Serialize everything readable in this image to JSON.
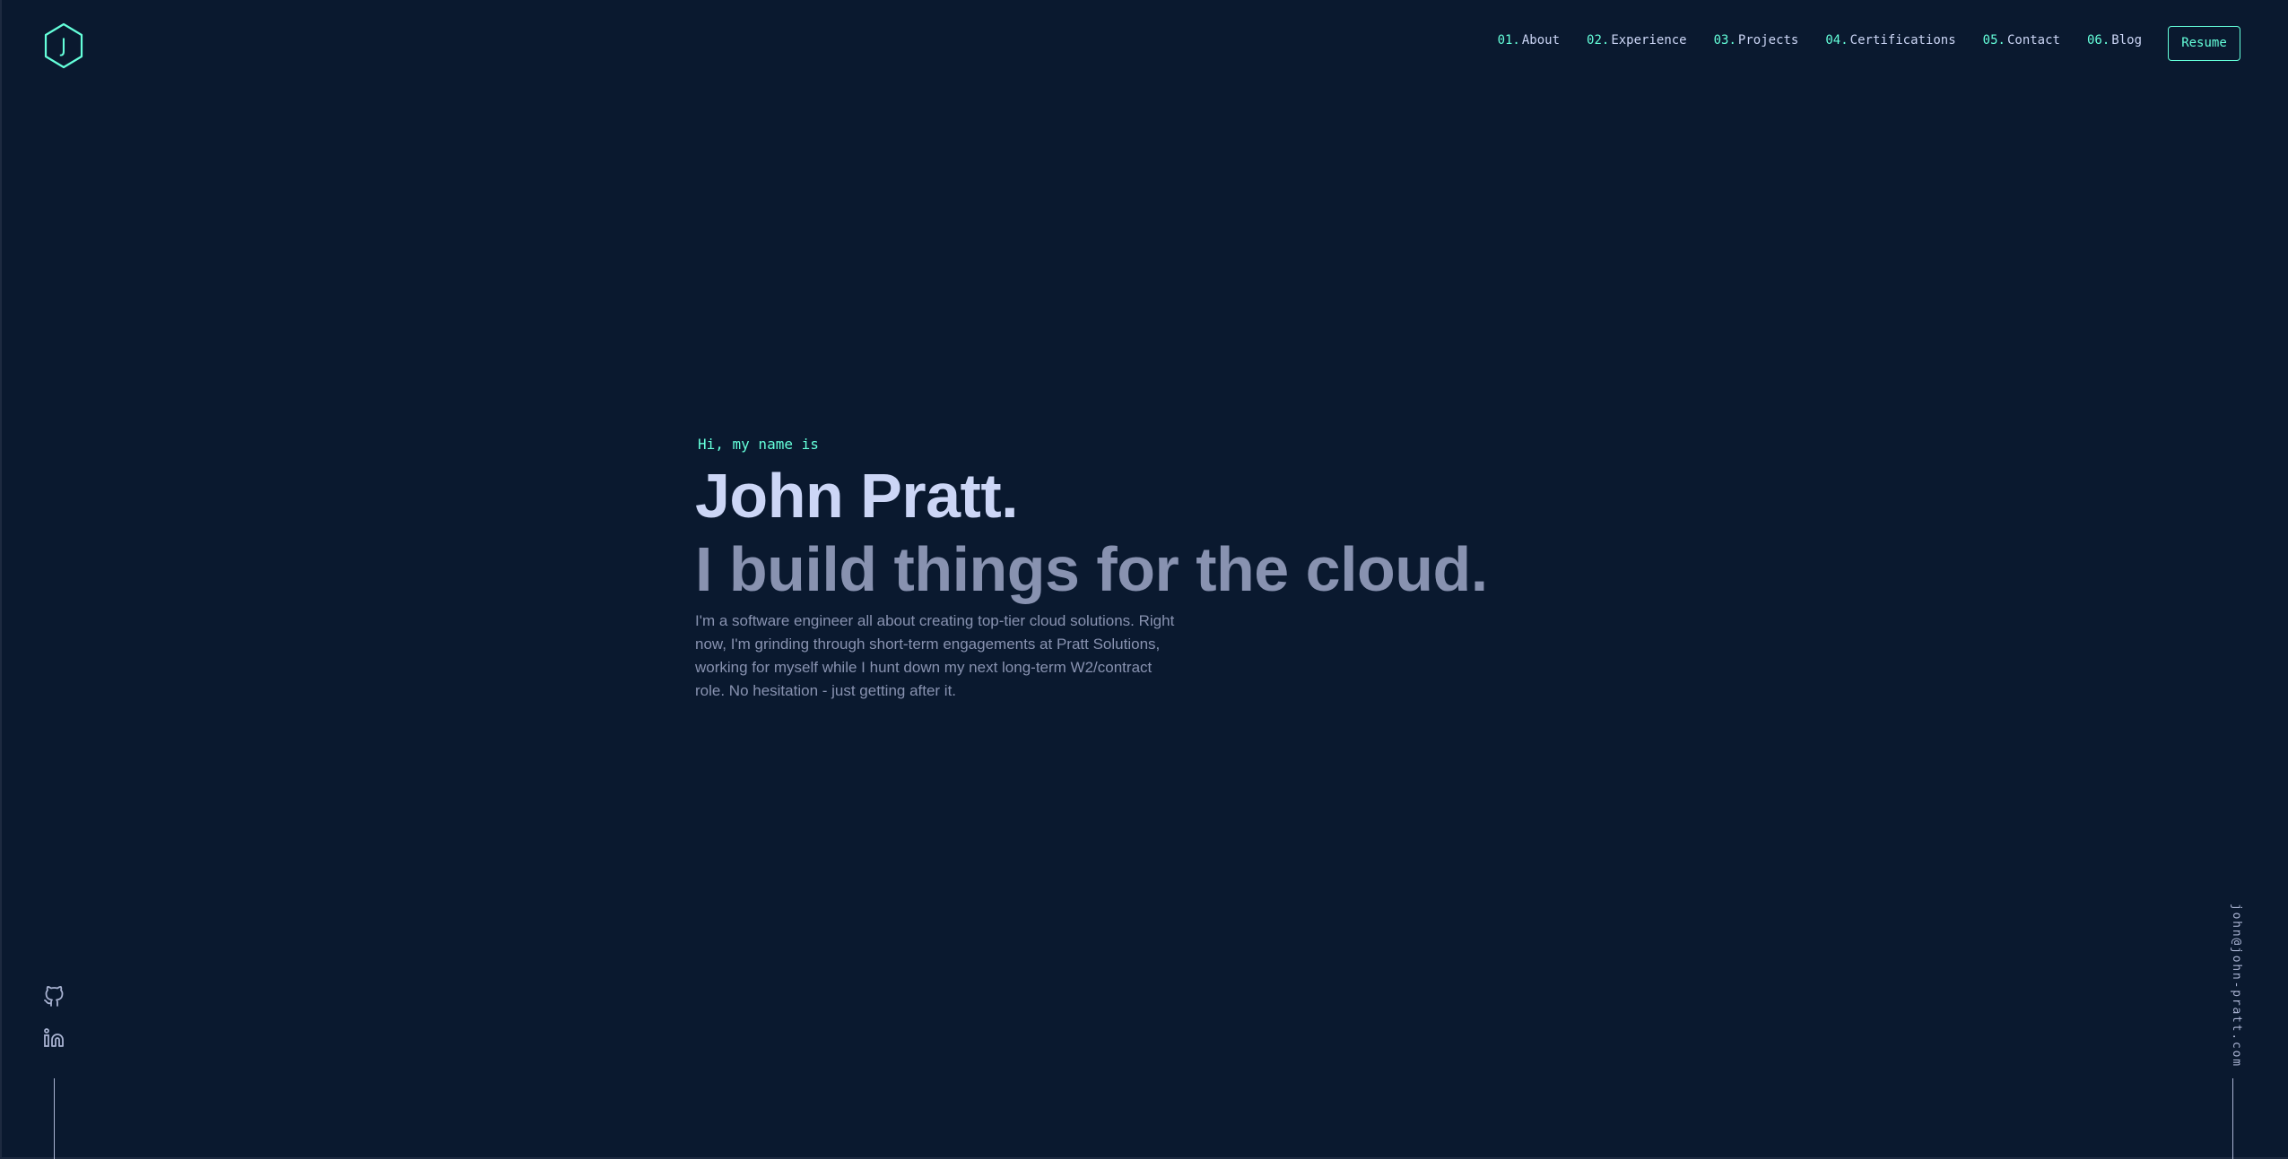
{
  "colors": {
    "background": "#0a192f",
    "accent": "#64ffda",
    "heading": "#ccd6f6",
    "text": "#8892b0",
    "line": "#a8b2d1"
  },
  "header": {
    "logo_letter": "J",
    "logo_icon": "hexagon-logo-icon",
    "nav": [
      {
        "num": "01.",
        "label": "About"
      },
      {
        "num": "02.",
        "label": "Experience"
      },
      {
        "num": "03.",
        "label": "Projects"
      },
      {
        "num": "04.",
        "label": "Certifications"
      },
      {
        "num": "05.",
        "label": "Contact"
      },
      {
        "num": "06.",
        "label": "Blog"
      }
    ],
    "resume_label": "Resume"
  },
  "hero": {
    "intro": "Hi, my name is",
    "name": "John Pratt.",
    "tagline": "I build things for the cloud.",
    "description": "I'm a software engineer all about creating top-tier cloud solutions. Right now, I'm grinding through short-term engagements at Pratt Solutions, working for myself while I hunt down my next long-term W2/contract role. No hesitation - just getting after it."
  },
  "social": {
    "icons": [
      "github-icon",
      "linkedin-icon"
    ]
  },
  "email": "john@john-pratt.com"
}
